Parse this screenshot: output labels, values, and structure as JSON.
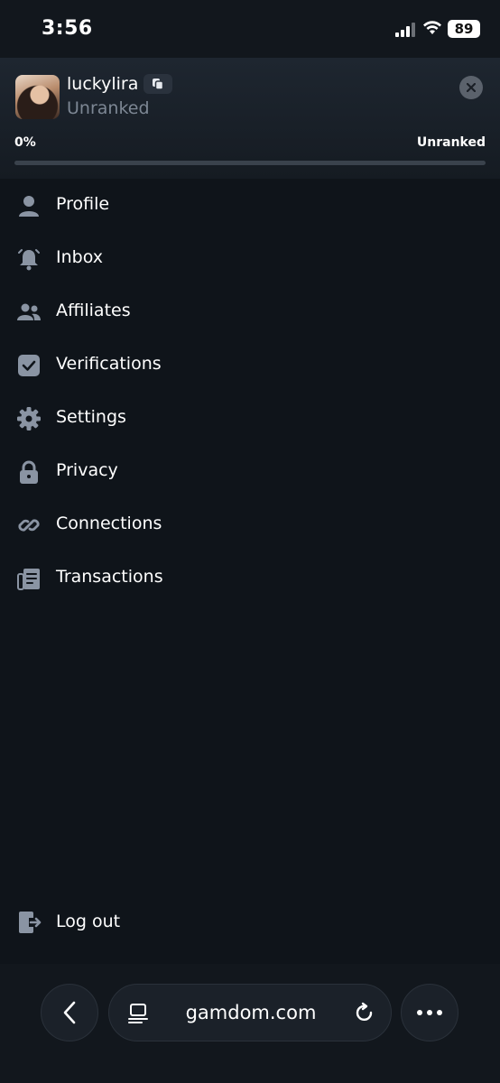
{
  "status_bar": {
    "time": "3:56",
    "battery": "89"
  },
  "profile": {
    "username": "luckylira",
    "rank_label": "Unranked",
    "progress_percent_label": "0%",
    "progress_fraction": 0,
    "progress_rank_label": "Unranked"
  },
  "menu": {
    "items": [
      {
        "label": "Profile",
        "icon": "user-icon"
      },
      {
        "label": "Inbox",
        "icon": "bell-icon"
      },
      {
        "label": "Affiliates",
        "icon": "users-icon"
      },
      {
        "label": "Verifications",
        "icon": "checkbox-icon"
      },
      {
        "label": "Settings",
        "icon": "gear-icon"
      },
      {
        "label": "Privacy",
        "icon": "lock-icon"
      },
      {
        "label": "Connections",
        "icon": "link-icon"
      },
      {
        "label": "Transactions",
        "icon": "receipt-icon"
      }
    ],
    "logout_label": "Log out"
  },
  "browser": {
    "url": "gamdom.com"
  },
  "colors": {
    "accent": "#8fd46a",
    "icon": "#8a94a3",
    "background": "#0f141a"
  }
}
